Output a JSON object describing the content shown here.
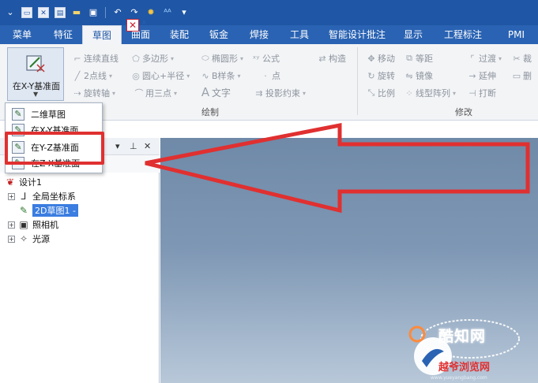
{
  "quick_access": [
    {
      "icon": "menu-icon"
    },
    {
      "icon": "new-file-icon"
    },
    {
      "icon": "close-file-icon"
    },
    {
      "icon": "print-icon"
    },
    {
      "icon": "open-folder-icon"
    },
    {
      "icon": "save-icon"
    },
    {
      "icon": "undo-icon"
    },
    {
      "icon": "redo-icon"
    },
    {
      "icon": "settings-icon"
    },
    {
      "icon": "text-icon"
    },
    {
      "icon": "customize-dropdown-icon"
    }
  ],
  "menubar": {
    "tabs": [
      {
        "label": "菜单",
        "active": false
      },
      {
        "label": "特征",
        "active": false
      },
      {
        "label": "草图",
        "active": true
      },
      {
        "label": "曲面",
        "active": false
      },
      {
        "label": "装配",
        "active": false
      },
      {
        "label": "钣金",
        "active": false
      },
      {
        "label": "焊接",
        "active": false
      },
      {
        "label": "工具",
        "active": false
      },
      {
        "label": "智能设计批注",
        "active": false
      },
      {
        "label": "显示",
        "active": false
      },
      {
        "label": "工程标注",
        "active": false
      },
      {
        "label": "PMI",
        "active": false
      }
    ]
  },
  "ribbon": {
    "big_button_label": "在X-Y基准面",
    "draw": {
      "group_label": "绘制",
      "items": [
        "连续直线",
        "多边形",
        "椭圆形",
        "公式",
        "构造",
        "2点线",
        "圆心+半径",
        "B样条",
        "点",
        "旋转轴",
        "用三点",
        "文字",
        "投影约束"
      ]
    },
    "modify": {
      "group_label": "修改",
      "items": [
        "移动",
        "等距",
        "过渡",
        "裁",
        "旋转",
        "镜像",
        "延伸",
        "删",
        "比例",
        "线型阵列",
        "打断"
      ]
    }
  },
  "dropdown": {
    "items": [
      "二维草图",
      "在X-Y基准面",
      "在Y-Z基准面",
      "在Z-X基准面"
    ]
  },
  "tree": {
    "items": [
      "设计1",
      "全局坐标系",
      "2D草图1 -",
      "照相机",
      "光源"
    ]
  },
  "watermark": {
    "title": "酷知网",
    "subtitle": "越爷浏览网",
    "url": "www.yueyangbang.com"
  },
  "colors": {
    "title_bar": "#1f56a5",
    "menubar": "#2a63b3",
    "highlight": "#e03030",
    "selection": "#3b7de0"
  }
}
